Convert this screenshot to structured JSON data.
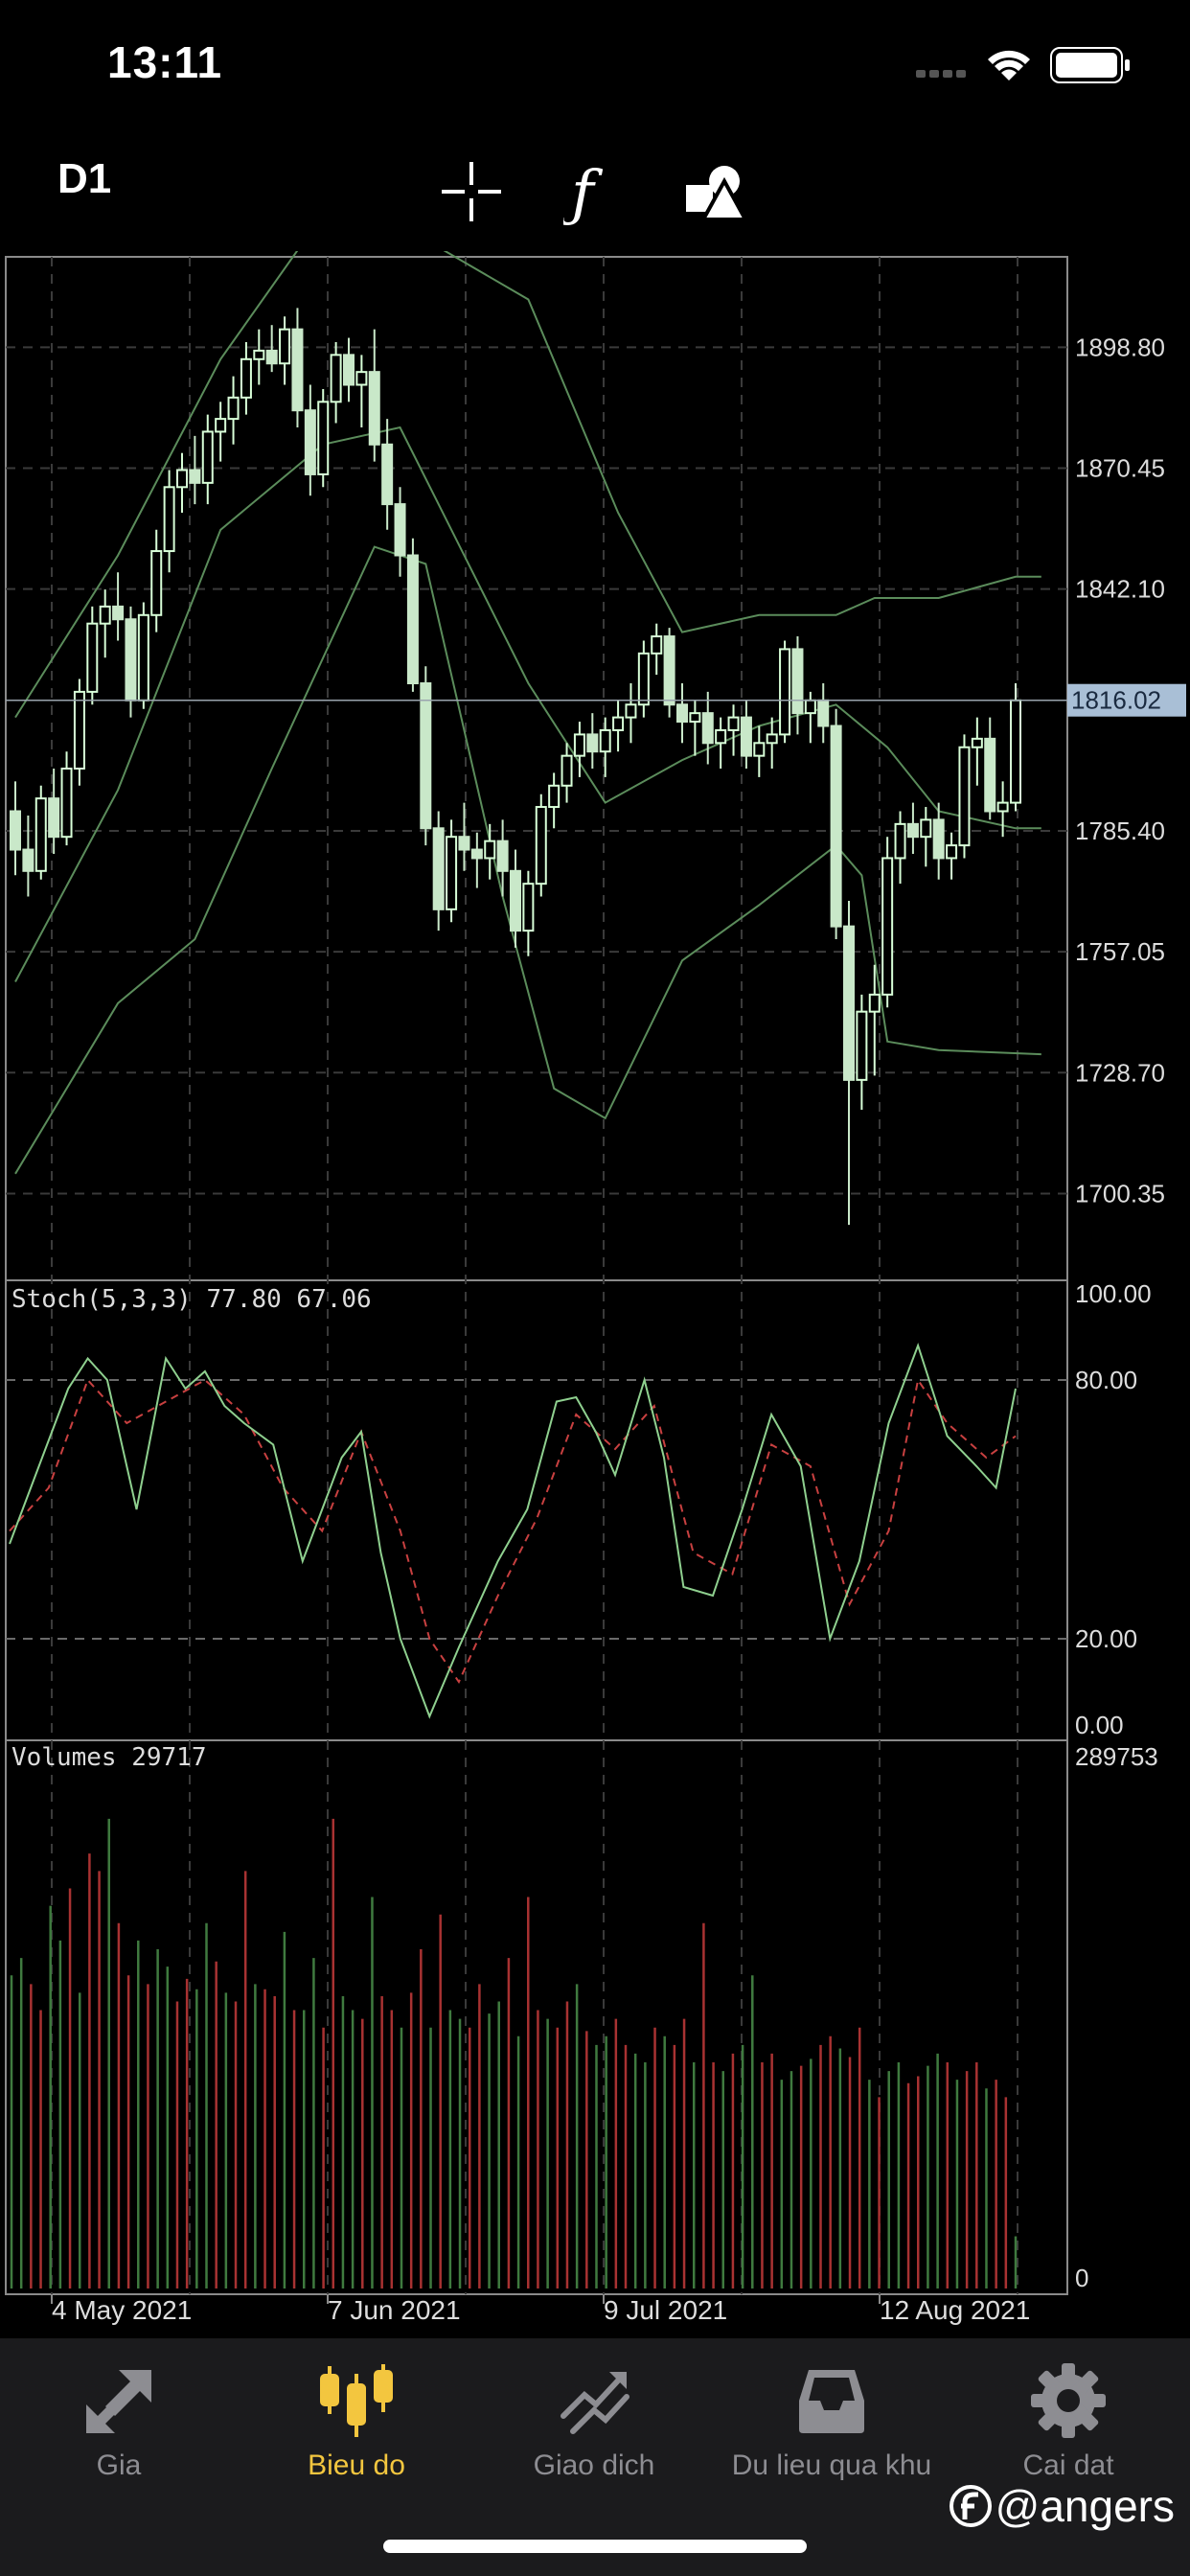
{
  "status": {
    "time": "13:11"
  },
  "toolbar": {
    "timeframe": "D1",
    "tools": [
      {
        "name": "crosshair-icon"
      },
      {
        "name": "function-icon"
      },
      {
        "name": "shapes-icon"
      }
    ]
  },
  "chart_data": {
    "type": "candlestick",
    "symbol_timeframe": "D1",
    "price_axis": {
      "ticks": [
        1898.8,
        1870.45,
        1842.1,
        1785.4,
        1757.05,
        1728.7,
        1700.35
      ],
      "current_price": "1816.02",
      "range": [
        1680,
        1920
      ]
    },
    "x_labels": [
      "4 May 2021",
      "7 Jun 2021",
      "9 Jul 2021",
      "12 Aug 2021"
    ],
    "candles": [
      [
        1790,
        1797,
        1775,
        1781
      ],
      [
        1781,
        1789,
        1770,
        1776
      ],
      [
        1776,
        1796,
        1774,
        1793
      ],
      [
        1793,
        1800,
        1780,
        1784
      ],
      [
        1784,
        1804,
        1782,
        1800
      ],
      [
        1800,
        1821,
        1796,
        1818
      ],
      [
        1818,
        1838,
        1815,
        1834
      ],
      [
        1834,
        1842,
        1826,
        1838
      ],
      [
        1838,
        1846,
        1830,
        1835
      ],
      [
        1835,
        1838,
        1812,
        1816
      ],
      [
        1816,
        1839,
        1814,
        1836
      ],
      [
        1836,
        1856,
        1832,
        1851
      ],
      [
        1851,
        1870,
        1846,
        1866
      ],
      [
        1866,
        1874,
        1860,
        1870
      ],
      [
        1870,
        1878,
        1862,
        1867
      ],
      [
        1867,
        1883,
        1862,
        1879
      ],
      [
        1879,
        1886,
        1872,
        1882
      ],
      [
        1882,
        1892,
        1876,
        1887
      ],
      [
        1887,
        1900,
        1883,
        1896
      ],
      [
        1896,
        1903,
        1890,
        1898
      ],
      [
        1898,
        1904,
        1893,
        1895
      ],
      [
        1895,
        1906,
        1890,
        1903
      ],
      [
        1903,
        1908,
        1880,
        1884
      ],
      [
        1884,
        1890,
        1864,
        1869
      ],
      [
        1869,
        1889,
        1866,
        1886
      ],
      [
        1886,
        1900,
        1881,
        1897
      ],
      [
        1897,
        1901,
        1886,
        1890
      ],
      [
        1890,
        1897,
        1880,
        1893
      ],
      [
        1893,
        1903,
        1872,
        1876
      ],
      [
        1876,
        1882,
        1856,
        1862
      ],
      [
        1862,
        1866,
        1845,
        1850
      ],
      [
        1850,
        1854,
        1818,
        1820
      ],
      [
        1820,
        1824,
        1782,
        1786
      ],
      [
        1786,
        1790,
        1762,
        1767
      ],
      [
        1767,
        1788,
        1764,
        1784
      ],
      [
        1784,
        1792,
        1776,
        1781
      ],
      [
        1781,
        1785,
        1772,
        1779
      ],
      [
        1779,
        1787,
        1774,
        1783
      ],
      [
        1783,
        1788,
        1770,
        1776
      ],
      [
        1776,
        1781,
        1758,
        1762
      ],
      [
        1762,
        1776,
        1756,
        1773
      ],
      [
        1773,
        1794,
        1770,
        1791
      ],
      [
        1791,
        1799,
        1786,
        1796
      ],
      [
        1796,
        1806,
        1792,
        1803
      ],
      [
        1803,
        1811,
        1798,
        1808
      ],
      [
        1808,
        1813,
        1800,
        1804
      ],
      [
        1804,
        1812,
        1798,
        1809
      ],
      [
        1809,
        1816,
        1804,
        1812
      ],
      [
        1812,
        1820,
        1806,
        1815
      ],
      [
        1815,
        1830,
        1812,
        1827
      ],
      [
        1827,
        1834,
        1822,
        1831
      ],
      [
        1831,
        1833,
        1812,
        1815
      ],
      [
        1815,
        1820,
        1806,
        1811
      ],
      [
        1811,
        1816,
        1803,
        1813
      ],
      [
        1813,
        1818,
        1801,
        1806
      ],
      [
        1806,
        1812,
        1800,
        1809
      ],
      [
        1809,
        1815,
        1803,
        1812
      ],
      [
        1812,
        1816,
        1800,
        1803
      ],
      [
        1803,
        1810,
        1798,
        1806
      ],
      [
        1806,
        1812,
        1800,
        1808
      ],
      [
        1808,
        1830,
        1806,
        1828
      ],
      [
        1828,
        1831,
        1808,
        1813
      ],
      [
        1813,
        1818,
        1806,
        1816
      ],
      [
        1816,
        1820,
        1806,
        1810
      ],
      [
        1810,
        1814,
        1760,
        1763
      ],
      [
        1763,
        1769,
        1693,
        1727
      ],
      [
        1727,
        1747,
        1720,
        1743
      ],
      [
        1743,
        1754,
        1728,
        1747
      ],
      [
        1747,
        1784,
        1744,
        1779
      ],
      [
        1779,
        1790,
        1773,
        1787
      ],
      [
        1787,
        1792,
        1780,
        1784
      ],
      [
        1784,
        1791,
        1777,
        1788
      ],
      [
        1788,
        1792,
        1774,
        1779
      ],
      [
        1779,
        1785,
        1774,
        1782
      ],
      [
        1782,
        1808,
        1779,
        1805
      ],
      [
        1805,
        1812,
        1796,
        1807
      ],
      [
        1807,
        1812,
        1788,
        1790
      ],
      [
        1790,
        1797,
        1784,
        1792
      ],
      [
        1792,
        1820,
        1790,
        1816
      ]
    ],
    "bollinger": {
      "upper": [
        [
          0,
          1812
        ],
        [
          8,
          1850
        ],
        [
          16,
          1896
        ],
        [
          24,
          1930
        ],
        [
          32,
          1924
        ],
        [
          40,
          1910
        ],
        [
          47,
          1860
        ],
        [
          52,
          1832
        ],
        [
          58,
          1836
        ],
        [
          64,
          1836
        ],
        [
          67,
          1840
        ],
        [
          72,
          1840
        ],
        [
          78,
          1845
        ],
        [
          80,
          1845
        ]
      ],
      "middle": [
        [
          0,
          1750
        ],
        [
          8,
          1795
        ],
        [
          16,
          1856
        ],
        [
          24,
          1876
        ],
        [
          30,
          1880
        ],
        [
          34,
          1856
        ],
        [
          40,
          1820
        ],
        [
          46,
          1792
        ],
        [
          52,
          1802
        ],
        [
          58,
          1810
        ],
        [
          64,
          1815
        ],
        [
          68,
          1805
        ],
        [
          72,
          1790
        ],
        [
          78,
          1786
        ],
        [
          80,
          1786
        ]
      ],
      "lower": [
        [
          0,
          1705
        ],
        [
          8,
          1745
        ],
        [
          14,
          1760
        ],
        [
          20,
          1800
        ],
        [
          28,
          1852
        ],
        [
          32,
          1848
        ],
        [
          38,
          1770
        ],
        [
          42,
          1725
        ],
        [
          46,
          1718
        ],
        [
          52,
          1755
        ],
        [
          58,
          1768
        ],
        [
          64,
          1782
        ],
        [
          66,
          1775
        ],
        [
          68,
          1736
        ],
        [
          72,
          1734
        ],
        [
          80,
          1733
        ]
      ]
    },
    "stochastic": {
      "label": "Stoch(5,3,3) 77.80 67.06",
      "main": 77.8,
      "signal": 67.06,
      "levels": [
        100.0,
        80.0,
        20.0,
        0.0
      ],
      "main_series": [
        [
          0,
          42
        ],
        [
          3,
          60
        ],
        [
          6,
          78
        ],
        [
          8,
          85
        ],
        [
          10,
          80
        ],
        [
          13,
          50
        ],
        [
          16,
          85
        ],
        [
          18,
          78
        ],
        [
          20,
          82
        ],
        [
          22,
          74
        ],
        [
          24,
          70
        ],
        [
          27,
          65
        ],
        [
          30,
          38
        ],
        [
          34,
          62
        ],
        [
          36,
          68
        ],
        [
          38,
          40
        ],
        [
          40,
          20
        ],
        [
          43,
          2
        ],
        [
          46,
          18
        ],
        [
          50,
          38
        ],
        [
          53,
          50
        ],
        [
          56,
          75
        ],
        [
          58,
          76
        ],
        [
          60,
          68
        ],
        [
          62,
          58
        ],
        [
          65,
          80
        ],
        [
          67,
          62
        ],
        [
          69,
          32
        ],
        [
          72,
          30
        ],
        [
          75,
          50
        ],
        [
          78,
          72
        ],
        [
          81,
          60
        ],
        [
          84,
          20
        ],
        [
          87,
          38
        ],
        [
          90,
          70
        ],
        [
          93,
          88
        ],
        [
          96,
          67
        ],
        [
          99,
          60
        ],
        [
          101,
          55
        ],
        [
          103,
          78
        ]
      ],
      "signal_series": [
        [
          0,
          45
        ],
        [
          4,
          55
        ],
        [
          8,
          80
        ],
        [
          12,
          70
        ],
        [
          16,
          75
        ],
        [
          20,
          80
        ],
        [
          24,
          72
        ],
        [
          28,
          55
        ],
        [
          32,
          45
        ],
        [
          36,
          68
        ],
        [
          40,
          45
        ],
        [
          43,
          20
        ],
        [
          46,
          10
        ],
        [
          50,
          30
        ],
        [
          54,
          48
        ],
        [
          58,
          72
        ],
        [
          62,
          64
        ],
        [
          66,
          74
        ],
        [
          70,
          40
        ],
        [
          74,
          35
        ],
        [
          78,
          65
        ],
        [
          82,
          60
        ],
        [
          86,
          28
        ],
        [
          90,
          45
        ],
        [
          93,
          80
        ],
        [
          96,
          70
        ],
        [
          100,
          62
        ],
        [
          103,
          67
        ]
      ]
    },
    "volumes": {
      "label": "Volumes 29717",
      "max_label": "289753",
      "min_label": "0",
      "max": 289753,
      "values": [
        180000,
        190000,
        175000,
        160000,
        220000,
        200000,
        230000,
        170000,
        250000,
        240000,
        270000,
        210000,
        180000,
        200000,
        175000,
        195000,
        185000,
        165000,
        178000,
        172000,
        210000,
        188000,
        170000,
        165000,
        240000,
        175000,
        172000,
        168000,
        205000,
        160000,
        160000,
        190000,
        150000,
        270000,
        168000,
        160000,
        155000,
        225000,
        168000,
        160000,
        150000,
        170000,
        195000,
        150000,
        215000,
        160000,
        155000,
        150000,
        175000,
        158000,
        165000,
        190000,
        145000,
        225000,
        160000,
        155000,
        150000,
        165000,
        175000,
        148000,
        140000,
        145000,
        155000,
        140000,
        135000,
        130000,
        150000,
        145000,
        140000,
        155000,
        130000,
        210000,
        130000,
        125000,
        135000,
        140000,
        180000,
        130000,
        135000,
        120000,
        125000,
        128000,
        132000,
        140000,
        145000,
        138000,
        133000,
        150000,
        120000,
        110000,
        125000,
        130000,
        118000,
        122000,
        128000,
        135000,
        130000,
        120000,
        125000,
        130000,
        115000,
        120000,
        110000,
        30000
      ]
    }
  },
  "tabs": [
    {
      "label": "Gia",
      "icon": "arrows-icon",
      "active": false
    },
    {
      "label": "Bieu do",
      "icon": "candles-icon",
      "active": true
    },
    {
      "label": "Giao dich",
      "icon": "trend-icon",
      "active": false
    },
    {
      "label": "Du lieu qua khu",
      "icon": "inbox-icon",
      "active": false
    },
    {
      "label": "Cai dat",
      "icon": "gear-icon",
      "active": false
    }
  ],
  "watermark": "@angers",
  "colors": {
    "background": "#000000",
    "grid": "#3a3a3a",
    "bull": "#d8ffd8",
    "bear": "#a83232",
    "bollinger": "#5b8c5b",
    "stoch_main": "#8fd08f",
    "stoch_signal": "#c84040",
    "active_tab": "#f3c63f"
  }
}
